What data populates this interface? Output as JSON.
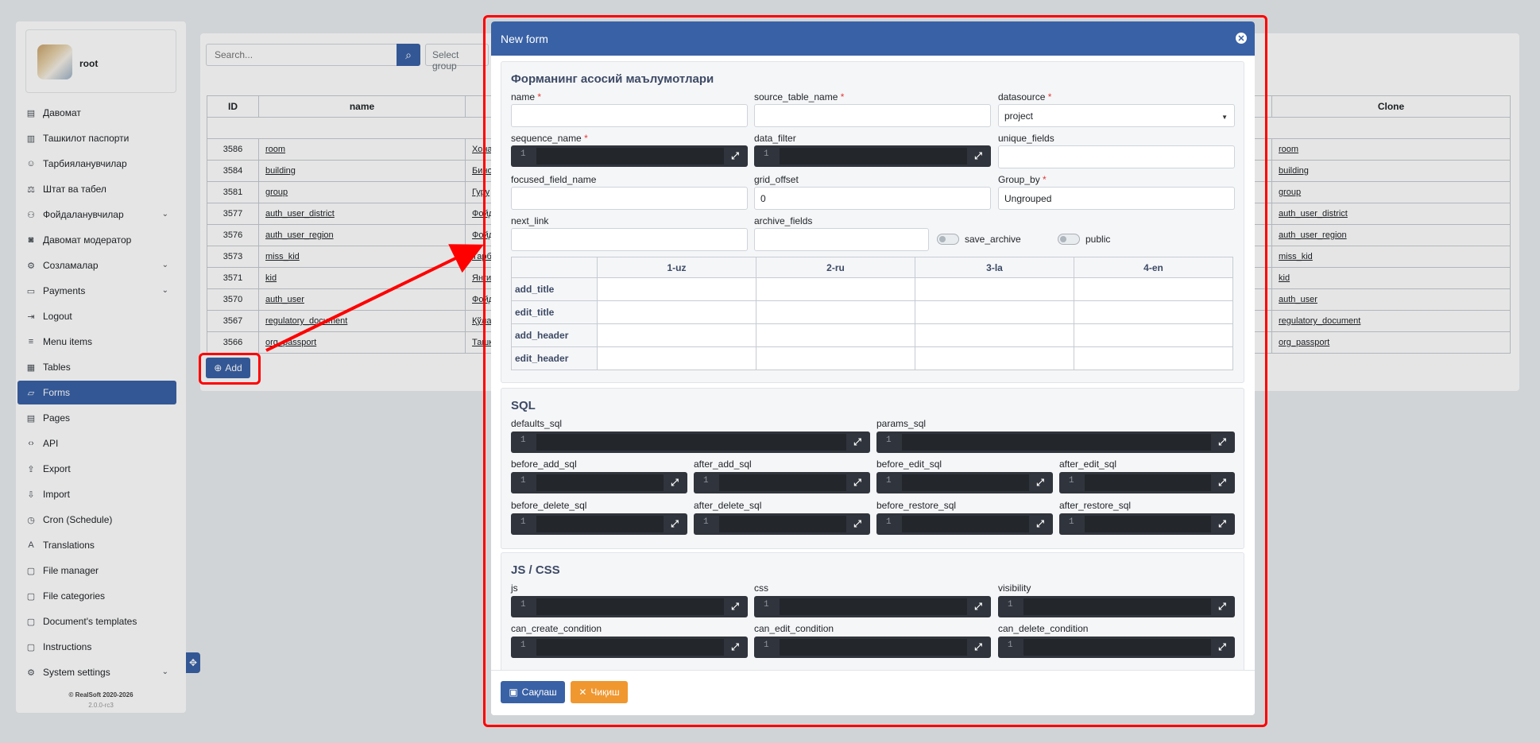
{
  "user": {
    "name": "root"
  },
  "sidebar": {
    "items": [
      {
        "label": "Давомат",
        "icon": "id-card-icon"
      },
      {
        "label": "Ташкилот паспорти",
        "icon": "passport-icon"
      },
      {
        "label": "Тарбияланувчилар",
        "icon": "child-icon"
      },
      {
        "label": "Штат ва табел",
        "icon": "staff-icon"
      },
      {
        "label": "Фойдаланувчилар",
        "icon": "users-icon",
        "expandable": true
      },
      {
        "label": "Давомат модератор",
        "icon": "camera-icon"
      },
      {
        "label": "Созламалар",
        "icon": "sliders-icon",
        "expandable": true
      },
      {
        "label": "Payments",
        "icon": "money-icon",
        "expandable": true
      },
      {
        "label": "Logout",
        "icon": "logout-icon"
      },
      {
        "label": "Menu items",
        "icon": "list-icon"
      },
      {
        "label": "Tables",
        "icon": "table-icon"
      },
      {
        "label": "Forms",
        "icon": "form-icon",
        "active": true
      },
      {
        "label": "Pages",
        "icon": "pages-icon"
      },
      {
        "label": "API",
        "icon": "code-icon"
      },
      {
        "label": "Export",
        "icon": "export-icon"
      },
      {
        "label": "Import",
        "icon": "import-icon"
      },
      {
        "label": "Cron (Schedule)",
        "icon": "clock-icon"
      },
      {
        "label": "Translations",
        "icon": "translate-icon"
      },
      {
        "label": "File manager",
        "icon": "folder-icon"
      },
      {
        "label": "File categories",
        "icon": "file-category-icon"
      },
      {
        "label": "Document's templates",
        "icon": "document-icon"
      },
      {
        "label": "Instructions",
        "icon": "instructions-icon"
      },
      {
        "label": "System settings",
        "icon": "gear-icon",
        "expandable": true
      }
    ],
    "copyright": "© RealSoft 2020-2026",
    "version": "2.0.0-rc3"
  },
  "toolbar": {
    "search_placeholder": "Search...",
    "group_placeholder": "Select group"
  },
  "table": {
    "headers": {
      "id": "ID",
      "name": "name",
      "clone": "Clone"
    },
    "rows": [
      {
        "id": "3586",
        "name": "room",
        "title": "Хона",
        "clone": "room"
      },
      {
        "id": "3584",
        "name": "building",
        "title": "Бино",
        "clone": "building"
      },
      {
        "id": "3581",
        "name": "group",
        "title": "Гуру",
        "clone": "group"
      },
      {
        "id": "3577",
        "name": "auth_user_district",
        "title": "Фойд",
        "clone": "auth_user_district"
      },
      {
        "id": "3576",
        "name": "auth_user_region",
        "title": "Фойд",
        "clone": "auth_user_region"
      },
      {
        "id": "3573",
        "name": "miss_kid",
        "title": "Тарб",
        "clone": "miss_kid"
      },
      {
        "id": "3571",
        "name": "kid",
        "title": "Янги",
        "clone": "kid"
      },
      {
        "id": "3570",
        "name": "auth_user",
        "title": "Фойд",
        "clone": "auth_user"
      },
      {
        "id": "3567",
        "name": "regulatory_document",
        "title": "Қўла",
        "clone": "regulatory_document"
      },
      {
        "id": "3566",
        "name": "org_passport",
        "title": "Ташк",
        "clone": "org_passport"
      }
    ],
    "add_label": "Add"
  },
  "modal": {
    "title": "New form",
    "main_section": {
      "title": "Форманинг асосий маълумотлари",
      "name_label": "name",
      "source_table_name_label": "source_table_name",
      "datasource_label": "datasource",
      "datasource_value": "project",
      "sequence_name_label": "sequence_name",
      "data_filter_label": "data_filter",
      "unique_fields_label": "unique_fields",
      "focused_field_name_label": "focused_field_name",
      "grid_offset_label": "grid_offset",
      "grid_offset_value": "0",
      "group_by_label": "Group_by",
      "group_by_value": "Ungrouped",
      "next_link_label": "next_link",
      "archive_fields_label": "archive_fields",
      "save_archive_label": "save_archive",
      "save_archive_on": false,
      "public_label": "public",
      "public_on": false,
      "required_mark": "*"
    },
    "lang_table": {
      "columns": [
        "1-uz",
        "2-ru",
        "3-la",
        "4-en"
      ],
      "rows": [
        "add_title",
        "edit_title",
        "add_header",
        "edit_header"
      ]
    },
    "sql_section": {
      "title": "SQL",
      "defaults_sql": "defaults_sql",
      "params_sql": "params_sql",
      "before_add_sql": "before_add_sql",
      "after_add_sql": "after_add_sql",
      "before_edit_sql": "before_edit_sql",
      "after_edit_sql": "after_edit_sql",
      "before_delete_sql": "before_delete_sql",
      "after_delete_sql": "after_delete_sql",
      "before_restore_sql": "before_restore_sql",
      "after_restore_sql": "after_restore_sql"
    },
    "js_section": {
      "title": "JS / CSS",
      "js": "js",
      "css": "css",
      "visibility": "visibility",
      "can_create_condition": "can_create_condition",
      "can_edit_condition": "can_edit_condition",
      "can_delete_condition": "can_delete_condition"
    },
    "code_line_number": "1",
    "save_label": "Сақлаш",
    "exit_label": "Чиқиш"
  },
  "colors": {
    "primary": "#3961a6",
    "warning": "#f0972f",
    "annotation": "#ff0000"
  }
}
